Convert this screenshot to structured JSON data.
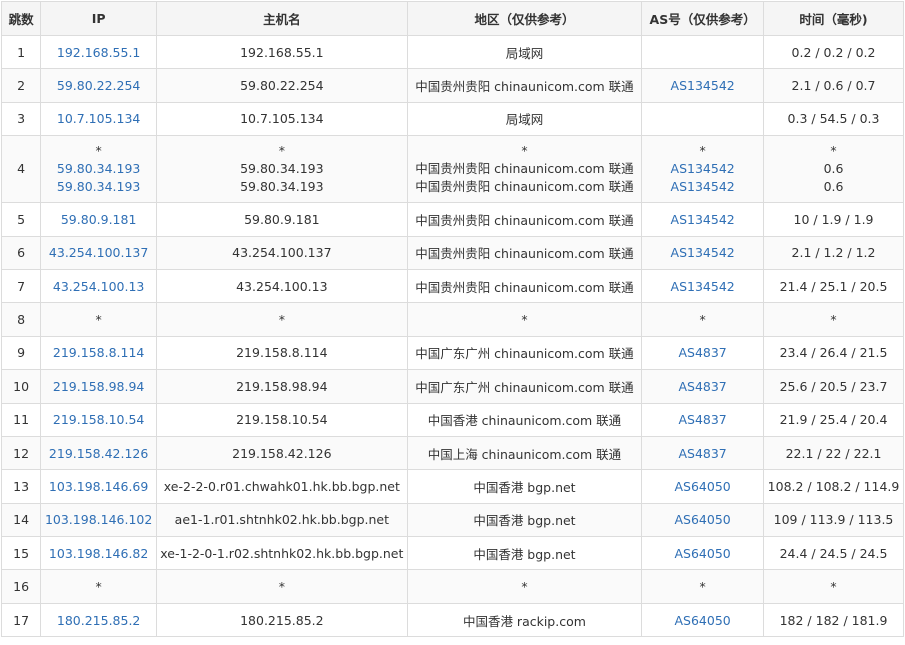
{
  "headers": {
    "hop": "跳数",
    "ip": "IP",
    "host": "主机名",
    "region": "地区（仅供参考）",
    "as": "AS号（仅供参考）",
    "time": "时间（毫秒)"
  },
  "colors": {
    "link": "#2f6fb5",
    "header_bg": "#f5f5f5",
    "border": "#dcdcdc"
  },
  "rows": [
    {
      "hop": "1",
      "ip": "192.168.55.1",
      "host": "192.168.55.1",
      "region": "局域网",
      "as": "",
      "time": "0.2 / 0.2 / 0.2"
    },
    {
      "hop": "2",
      "ip": "59.80.22.254",
      "host": "59.80.22.254",
      "region": "中国贵州贵阳 chinaunicom.com 联通",
      "as": "AS134542",
      "time": "2.1 / 0.6 / 0.7"
    },
    {
      "hop": "3",
      "ip": "10.7.105.134",
      "host": "10.7.105.134",
      "region": "局域网",
      "as": "",
      "time": "0.3 / 54.5 / 0.3"
    },
    {
      "hop": "4",
      "multi": true,
      "ip": [
        "*",
        "59.80.34.193",
        "59.80.34.193"
      ],
      "host": [
        "*",
        "59.80.34.193",
        "59.80.34.193"
      ],
      "region": [
        "*",
        "中国贵州贵阳 chinaunicom.com 联通",
        "中国贵州贵阳 chinaunicom.com 联通"
      ],
      "as": [
        "*",
        "AS134542",
        "AS134542"
      ],
      "time": [
        "*",
        "0.6",
        "0.6"
      ]
    },
    {
      "hop": "5",
      "ip": "59.80.9.181",
      "host": "59.80.9.181",
      "region": "中国贵州贵阳 chinaunicom.com 联通",
      "as": "AS134542",
      "time": "10 / 1.9 / 1.9"
    },
    {
      "hop": "6",
      "ip": "43.254.100.137",
      "host": "43.254.100.137",
      "region": "中国贵州贵阳 chinaunicom.com 联通",
      "as": "AS134542",
      "time": "2.1 / 1.2 / 1.2"
    },
    {
      "hop": "7",
      "ip": "43.254.100.13",
      "host": "43.254.100.13",
      "region": "中国贵州贵阳 chinaunicom.com 联通",
      "as": "AS134542",
      "time": "21.4 / 25.1 / 20.5"
    },
    {
      "hop": "8",
      "ip": "*",
      "host": "*",
      "region": "*",
      "as": "*",
      "time": "*"
    },
    {
      "hop": "9",
      "ip": "219.158.8.114",
      "host": "219.158.8.114",
      "region": "中国广东广州 chinaunicom.com 联通",
      "as": "AS4837",
      "time": "23.4 / 26.4 / 21.5"
    },
    {
      "hop": "10",
      "ip": "219.158.98.94",
      "host": "219.158.98.94",
      "region": "中国广东广州 chinaunicom.com 联通",
      "as": "AS4837",
      "time": "25.6 / 20.5 / 23.7"
    },
    {
      "hop": "11",
      "ip": "219.158.10.54",
      "host": "219.158.10.54",
      "region": "中国香港 chinaunicom.com 联通",
      "as": "AS4837",
      "time": "21.9 / 25.4 / 20.4"
    },
    {
      "hop": "12",
      "ip": "219.158.42.126",
      "host": "219.158.42.126",
      "region": "中国上海 chinaunicom.com 联通",
      "as": "AS4837",
      "time": "22.1 / 22 / 22.1"
    },
    {
      "hop": "13",
      "ip": "103.198.146.69",
      "host": "xe-2-2-0.r01.chwahk01.hk.bb.bgp.net",
      "region": "中国香港 bgp.net",
      "as": "AS64050",
      "time": "108.2 / 108.2 / 114.9"
    },
    {
      "hop": "14",
      "ip": "103.198.146.102",
      "host": "ae1-1.r01.shtnhk02.hk.bb.bgp.net",
      "region": "中国香港 bgp.net",
      "as": "AS64050",
      "time": "109 / 113.9 / 113.5"
    },
    {
      "hop": "15",
      "ip": "103.198.146.82",
      "host": "xe-1-2-0-1.r02.shtnhk02.hk.bb.bgp.net",
      "region": "中国香港 bgp.net",
      "as": "AS64050",
      "time": "24.4 / 24.5 / 24.5"
    },
    {
      "hop": "16",
      "ip": "*",
      "host": "*",
      "region": "*",
      "as": "*",
      "time": "*"
    },
    {
      "hop": "17",
      "ip": "180.215.85.2",
      "host": "180.215.85.2",
      "region": "中国香港 rackip.com",
      "as": "AS64050",
      "time": "182 / 182 / 181.9"
    }
  ]
}
